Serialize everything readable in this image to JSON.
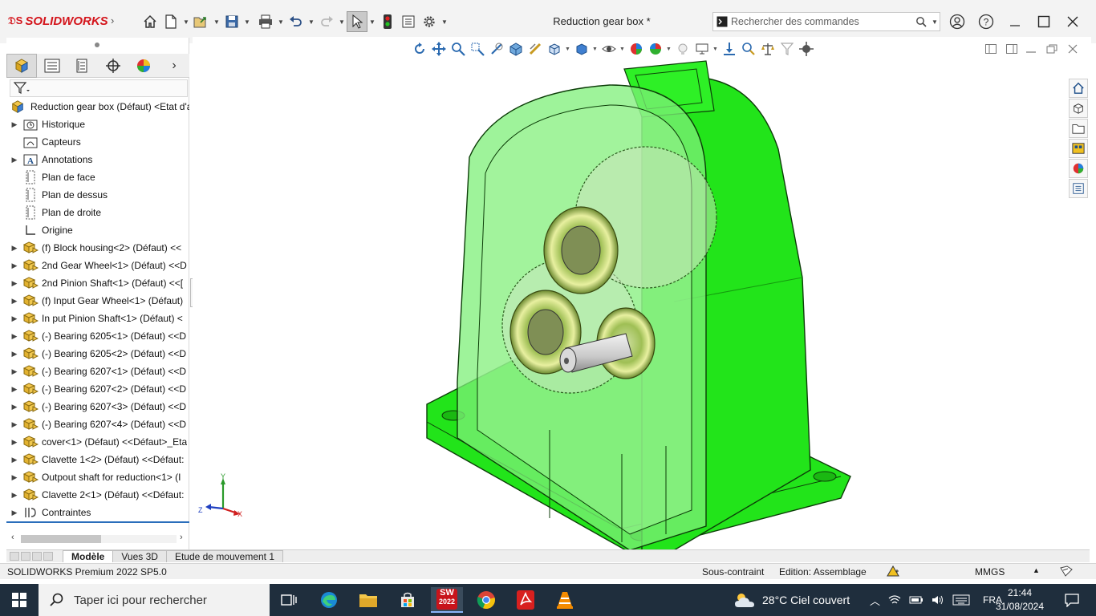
{
  "app": {
    "brand": "SOLIDWORKS",
    "document_title": "Reduction gear box *",
    "accent": "#d4141b"
  },
  "search": {
    "placeholder": "Rechercher des commandes"
  },
  "toolbar_icons": [
    "home-icon",
    "new-document-icon",
    "open-icon",
    "save-icon",
    "print-icon",
    "undo-icon",
    "redo-icon",
    "select-arrow-icon",
    "traffic-light-icon",
    "file-properties-icon",
    "options-gear-icon"
  ],
  "window_controls": [
    "account-icon",
    "help-icon",
    "minimize-icon",
    "maximize-icon",
    "close-icon"
  ],
  "feature_tree": {
    "root": "Reduction gear box (Défaut) <Etat d'a",
    "items": [
      {
        "label": "Historique",
        "icon": "history-folder-icon",
        "expandable": true
      },
      {
        "label": "Capteurs",
        "icon": "sensor-icon",
        "expandable": false
      },
      {
        "label": "Annotations",
        "icon": "annotations-icon",
        "expandable": true
      },
      {
        "label": "Plan de face",
        "icon": "plane-icon",
        "expandable": false
      },
      {
        "label": "Plan de dessus",
        "icon": "plane-icon",
        "expandable": false
      },
      {
        "label": "Plan de droite",
        "icon": "plane-icon",
        "expandable": false
      },
      {
        "label": "Origine",
        "icon": "origin-icon",
        "expandable": false
      },
      {
        "label": "(f) Block housing<2> (Défaut) <<",
        "icon": "part-icon",
        "expandable": true
      },
      {
        "label": "2nd Gear Wheel<1> (Défaut) <<D",
        "icon": "part-icon",
        "expandable": true
      },
      {
        "label": "2nd Pinion Shaft<1> (Défaut) <<[",
        "icon": "part-icon",
        "expandable": true
      },
      {
        "label": "(f) Input Gear Wheel<1> (Défaut)",
        "icon": "part-icon",
        "expandable": true
      },
      {
        "label": "In put Pinion Shaft<1> (Défaut) <",
        "icon": "part-icon",
        "expandable": true
      },
      {
        "label": "(-) Bearing 6205<1> (Défaut) <<D",
        "icon": "part-icon",
        "expandable": true
      },
      {
        "label": "(-) Bearing 6205<2> (Défaut) <<D",
        "icon": "part-icon",
        "expandable": true
      },
      {
        "label": "(-) Bearing 6207<1> (Défaut) <<D",
        "icon": "part-icon",
        "expandable": true
      },
      {
        "label": "(-) Bearing 6207<2> (Défaut) <<D",
        "icon": "part-icon",
        "expandable": true
      },
      {
        "label": "(-) Bearing 6207<3> (Défaut) <<D",
        "icon": "part-icon",
        "expandable": true
      },
      {
        "label": "(-) Bearing 6207<4> (Défaut) <<D",
        "icon": "part-icon",
        "expandable": true
      },
      {
        "label": "cover<1> (Défaut) <<Défaut>_Eta",
        "icon": "part-icon",
        "expandable": true
      },
      {
        "label": "Clavette 1<2> (Défaut) <<Défaut:",
        "icon": "part-icon",
        "expandable": true
      },
      {
        "label": "Outpout shaft for reduction<1> (I",
        "icon": "part-icon",
        "expandable": true
      },
      {
        "label": "Clavette 2<1> (Défaut) <<Défaut:",
        "icon": "part-icon",
        "expandable": true
      },
      {
        "label": "Contraintes",
        "icon": "mates-icon",
        "expandable": true
      }
    ]
  },
  "bottom_tabs": [
    "Modèle",
    "Vues 3D",
    "Etude de mouvement 1"
  ],
  "status": {
    "product": "SOLIDWORKS Premium 2022 SP5.0",
    "constraint": "Sous-contraint",
    "mode": "Edition: Assemblage",
    "units": "MMGS"
  },
  "triad": {
    "x": "X",
    "y": "Y",
    "z": "Z"
  },
  "model_color": "#22e41a",
  "taskbar": {
    "search_placeholder": "Taper ici pour rechercher",
    "sw_badge": "2022",
    "weather": "28°C  Ciel couvert",
    "lang": "FRA",
    "time": "21:44",
    "date": "31/08/2024"
  }
}
